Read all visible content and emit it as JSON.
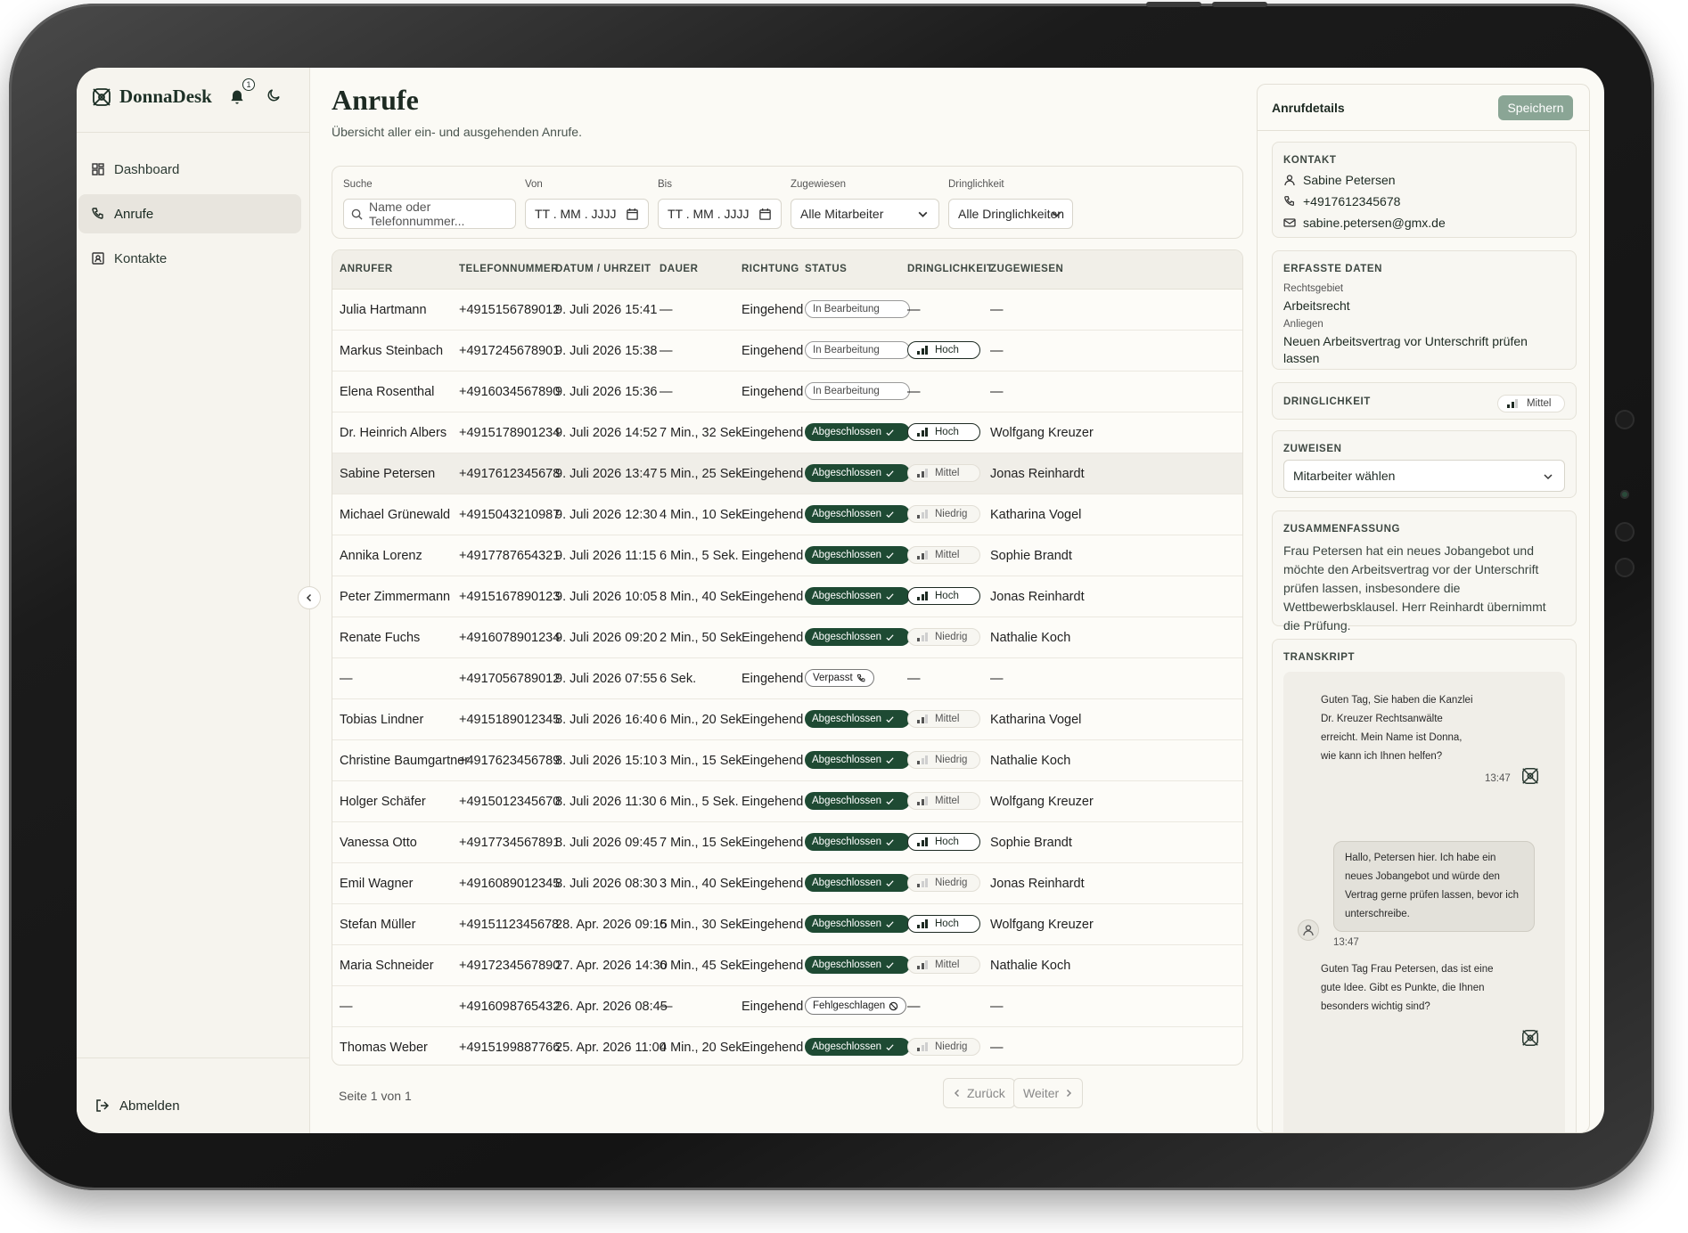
{
  "app": {
    "name": "DonnaDesk",
    "notification_count": "1"
  },
  "sidebar": {
    "items": [
      {
        "label": "Dashboard",
        "icon": "dashboard-icon",
        "active": false
      },
      {
        "label": "Anrufe",
        "icon": "phone-icon",
        "active": true
      },
      {
        "label": "Kontakte",
        "icon": "contacts-icon",
        "active": false
      }
    ],
    "logout_label": "Abmelden"
  },
  "main": {
    "title": "Anrufe",
    "subtitle": "Übersicht aller ein- und ausgehenden Anrufe."
  },
  "filters": {
    "search_label": "Suche",
    "search_placeholder": "Name oder Telefonnummer...",
    "from_label": "Von",
    "from_value": "TT . MM . JJJJ",
    "to_label": "Bis",
    "to_value": "TT . MM . JJJJ",
    "assigned_label": "Zugewiesen",
    "assigned_value": "Alle Mitarbeiter",
    "urgency_label": "Dringlichkeit",
    "urgency_value": "Alle Dringlichkeiten"
  },
  "table": {
    "headers": [
      "ANRUFER",
      "TELEFONNUMMER",
      "DATUM / UHRZEIT",
      "DAUER",
      "RICHTUNG",
      "STATUS",
      "DRINGLICHKEIT",
      "ZUGEWIESEN"
    ],
    "rows": [
      {
        "caller": "Julia Hartmann",
        "phone": "+4915156789012",
        "datetime": "9. Juli 2026 15:41",
        "duration": "—",
        "direction": "Eingehend",
        "status": "In Bearbeitung",
        "status_type": "prog",
        "urgency": "—",
        "urgency_level": 0,
        "assigned": "—"
      },
      {
        "caller": "Markus Steinbach",
        "phone": "+4917245678901",
        "datetime": "9. Juli 2026 15:38",
        "duration": "—",
        "direction": "Eingehend",
        "status": "In Bearbeitung",
        "status_type": "prog",
        "urgency": "Hoch",
        "urgency_level": 3,
        "assigned": "—"
      },
      {
        "caller": "Elena Rosenthal",
        "phone": "+4916034567890",
        "datetime": "9. Juli 2026 15:36",
        "duration": "—",
        "direction": "Eingehend",
        "status": "In Bearbeitung",
        "status_type": "prog",
        "urgency": "—",
        "urgency_level": 0,
        "assigned": "—"
      },
      {
        "caller": "Dr. Heinrich Albers",
        "phone": "+4915178901234",
        "datetime": "9. Juli 2026 14:52",
        "duration": "7 Min., 32 Sek.",
        "direction": "Eingehend",
        "status": "Abgeschlossen",
        "status_type": "done",
        "urgency": "Hoch",
        "urgency_level": 3,
        "assigned": "Wolfgang Kreuzer"
      },
      {
        "caller": "Sabine Petersen",
        "phone": "+4917612345678",
        "datetime": "9. Juli 2026 13:47",
        "duration": "5 Min., 25 Sek.",
        "direction": "Eingehend",
        "status": "Abgeschlossen",
        "status_type": "done",
        "urgency": "Mittel",
        "urgency_level": 2,
        "assigned": "Jonas Reinhardt",
        "selected": true
      },
      {
        "caller": "Michael Grünewald",
        "phone": "+4915043210987",
        "datetime": "9. Juli 2026 12:30",
        "duration": "4 Min., 10 Sek.",
        "direction": "Eingehend",
        "status": "Abgeschlossen",
        "status_type": "done",
        "urgency": "Niedrig",
        "urgency_level": 1,
        "assigned": "Katharina Vogel"
      },
      {
        "caller": "Annika Lorenz",
        "phone": "+4917787654321",
        "datetime": "9. Juli 2026 11:15",
        "duration": "6 Min., 5 Sek.",
        "direction": "Eingehend",
        "status": "Abgeschlossen",
        "status_type": "done",
        "urgency": "Mittel",
        "urgency_level": 2,
        "assigned": "Sophie Brandt"
      },
      {
        "caller": "Peter Zimmermann",
        "phone": "+4915167890123",
        "datetime": "9. Juli 2026 10:05",
        "duration": "8 Min., 40 Sek.",
        "direction": "Eingehend",
        "status": "Abgeschlossen",
        "status_type": "done",
        "urgency": "Hoch",
        "urgency_level": 3,
        "assigned": "Jonas Reinhardt"
      },
      {
        "caller": "Renate Fuchs",
        "phone": "+4916078901234",
        "datetime": "9. Juli 2026 09:20",
        "duration": "2 Min., 50 Sek.",
        "direction": "Eingehend",
        "status": "Abgeschlossen",
        "status_type": "done",
        "urgency": "Niedrig",
        "urgency_level": 1,
        "assigned": "Nathalie Koch"
      },
      {
        "caller": "—",
        "phone": "+4917056789012",
        "datetime": "9. Juli 2026 07:55",
        "duration": "6 Sek.",
        "direction": "Eingehend",
        "status": "Verpasst",
        "status_type": "miss",
        "urgency": "—",
        "urgency_level": 0,
        "assigned": "—"
      },
      {
        "caller": "Tobias Lindner",
        "phone": "+4915189012345",
        "datetime": "8. Juli 2026 16:40",
        "duration": "6 Min., 20 Sek.",
        "direction": "Eingehend",
        "status": "Abgeschlossen",
        "status_type": "done",
        "urgency": "Mittel",
        "urgency_level": 2,
        "assigned": "Katharina Vogel"
      },
      {
        "caller": "Christine Baumgartner",
        "phone": "+4917623456789",
        "datetime": "8. Juli 2026 15:10",
        "duration": "3 Min., 15 Sek.",
        "direction": "Eingehend",
        "status": "Abgeschlossen",
        "status_type": "done",
        "urgency": "Niedrig",
        "urgency_level": 1,
        "assigned": "Nathalie Koch"
      },
      {
        "caller": "Holger Schäfer",
        "phone": "+4915012345670",
        "datetime": "8. Juli 2026 11:30",
        "duration": "6 Min., 5 Sek.",
        "direction": "Eingehend",
        "status": "Abgeschlossen",
        "status_type": "done",
        "urgency": "Mittel",
        "urgency_level": 2,
        "assigned": "Wolfgang Kreuzer"
      },
      {
        "caller": "Vanessa Otto",
        "phone": "+4917734567891",
        "datetime": "8. Juli 2026 09:45",
        "duration": "7 Min., 15 Sek.",
        "direction": "Eingehend",
        "status": "Abgeschlossen",
        "status_type": "done",
        "urgency": "Hoch",
        "urgency_level": 3,
        "assigned": "Sophie Brandt"
      },
      {
        "caller": "Emil Wagner",
        "phone": "+4916089012345",
        "datetime": "8. Juli 2026 08:30",
        "duration": "3 Min., 40 Sek.",
        "direction": "Eingehend",
        "status": "Abgeschlossen",
        "status_type": "done",
        "urgency": "Niedrig",
        "urgency_level": 1,
        "assigned": "Jonas Reinhardt"
      },
      {
        "caller": "Stefan Müller",
        "phone": "+4915112345678",
        "datetime": "28. Apr. 2026 09:15",
        "duration": "6 Min., 30 Sek.",
        "direction": "Eingehend",
        "status": "Abgeschlossen",
        "status_type": "done",
        "urgency": "Hoch",
        "urgency_level": 3,
        "assigned": "Wolfgang Kreuzer"
      },
      {
        "caller": "Maria Schneider",
        "phone": "+4917234567890",
        "datetime": "27. Apr. 2026 14:30",
        "duration": "6 Min., 45 Sek.",
        "direction": "Eingehend",
        "status": "Abgeschlossen",
        "status_type": "done",
        "urgency": "Mittel",
        "urgency_level": 2,
        "assigned": "Nathalie Koch"
      },
      {
        "caller": "—",
        "phone": "+4916098765432",
        "datetime": "26. Apr. 2026 08:45",
        "duration": "—",
        "direction": "Eingehend",
        "status": "Fehlgeschlagen",
        "status_type": "fail",
        "urgency": "—",
        "urgency_level": 0,
        "assigned": "—"
      },
      {
        "caller": "Thomas Weber",
        "phone": "+4915199887766",
        "datetime": "25. Apr. 2026 11:00",
        "duration": "4 Min., 20 Sek.",
        "direction": "Eingehend",
        "status": "Abgeschlossen",
        "status_type": "done",
        "urgency": "Niedrig",
        "urgency_level": 1,
        "assigned": "—"
      }
    ]
  },
  "pagination": {
    "text": "Seite 1 von 1",
    "prev_label": "Zurück",
    "next_label": "Weiter"
  },
  "details": {
    "title": "Anrufdetails",
    "save_label": "Speichern",
    "contact": {
      "heading": "KONTAKT",
      "name": "Sabine Petersen",
      "phone": "+4917612345678",
      "email": "sabine.petersen@gmx.de"
    },
    "captured": {
      "heading": "ERFASSTE DATEN",
      "area_label": "Rechtsgebiet",
      "area_value": "Arbeitsrecht",
      "concern_label": "Anliegen",
      "concern_value": "Neuen Arbeitsvertrag vor Unterschrift prüfen lassen"
    },
    "urgency": {
      "heading": "DRINGLICHKEIT",
      "value": "Mittel"
    },
    "assign": {
      "heading": "ZUWEISEN",
      "placeholder": "Mitarbeiter wählen"
    },
    "summary": {
      "heading": "ZUSAMMENFASSUNG",
      "text": "Frau Petersen hat ein neues Jobangebot und möchte den Arbeitsvertrag vor der Unterschrift prüfen lassen, insbesondere die Wettbewerbsklausel. Herr Reinhardt übernimmt die Prüfung."
    },
    "transcript": {
      "heading": "TRANSKRIPT",
      "messages": [
        {
          "from": "bot",
          "text": "Guten Tag, Sie haben die Kanzlei Dr. Kreuzer Rechtsanwälte erreicht. Mein Name ist Donna, wie kann ich Ihnen helfen?",
          "time": "13:47"
        },
        {
          "from": "user",
          "text": "Hallo, Petersen hier. Ich habe ein neues Jobangebot und würde den Vertrag gerne prüfen lassen, bevor ich unterschreibe.",
          "time": "13:47"
        },
        {
          "from": "bot",
          "text": "Guten Tag Frau Petersen, das ist eine gute Idee. Gibt es Punkte, die Ihnen besonders wichtig sind?",
          "time": ""
        }
      ]
    }
  },
  "colors": {
    "brand_dark": "#1e4a33",
    "save_button": "#8aa595",
    "background": "#fbfaf5"
  }
}
